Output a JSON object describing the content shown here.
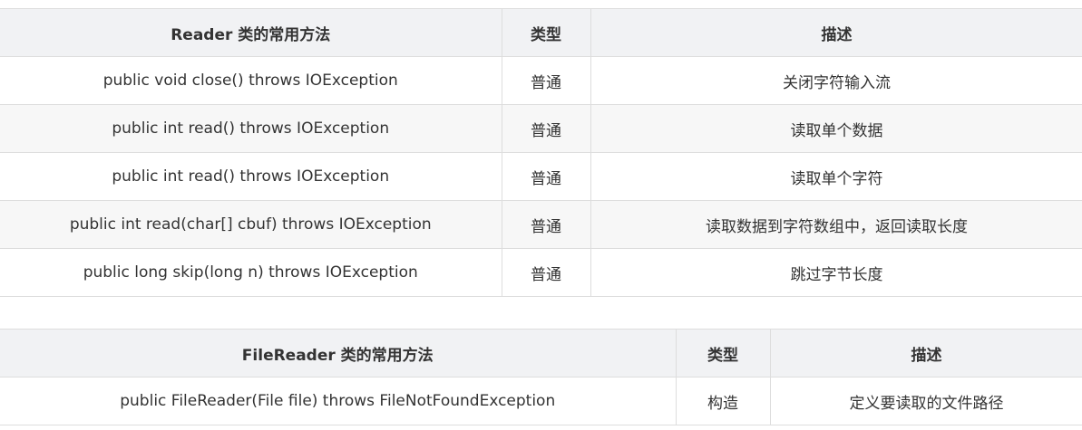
{
  "reader_table": {
    "headers": [
      "Reader 类的常用方法",
      "类型",
      "描述"
    ],
    "rows": [
      [
        "public void close() throws IOException",
        "普通",
        "关闭字符输入流"
      ],
      [
        "public int read() throws IOException",
        "普通",
        "读取单个数据"
      ],
      [
        "public int read() throws IOException",
        "普通",
        "读取单个字符"
      ],
      [
        "public int read(char[] cbuf) throws IOException",
        "普通",
        "读取数据到字符数组中，返回读取长度"
      ],
      [
        "public long skip(long n) throws IOException",
        "普通",
        "跳过字节长度"
      ]
    ]
  },
  "filereader_table": {
    "headers": [
      "FileReader 类的常用方法",
      "类型",
      "描述"
    ],
    "rows": [
      [
        "public FileReader(File file) throws FileNotFoundException",
        "构造",
        "定义要读取的文件路径"
      ]
    ]
  }
}
